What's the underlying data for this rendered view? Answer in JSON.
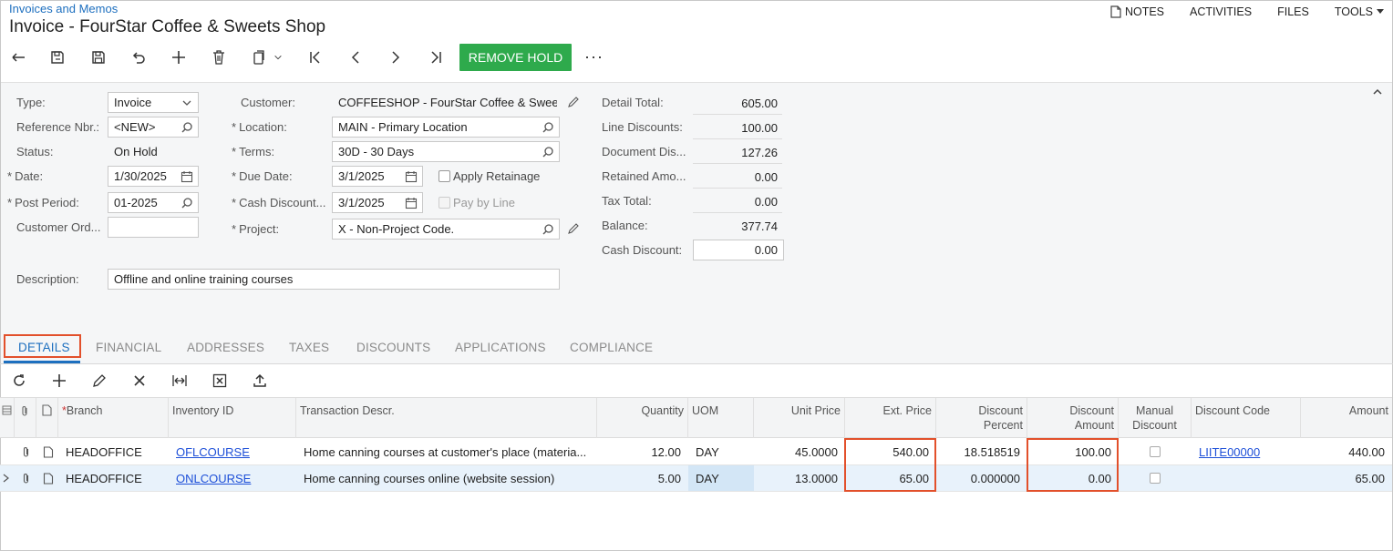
{
  "header": {
    "breadcrumb": "Invoices and Memos",
    "title": "Invoice - FourStar Coffee & Sweets Shop",
    "links": {
      "notes": "NOTES",
      "activities": "ACTIVITIES",
      "files": "FILES",
      "tools": "TOOLS"
    }
  },
  "toolbar": {
    "remove_hold": "REMOVE HOLD",
    "more": "···"
  },
  "form": {
    "type_label": "Type:",
    "type_value": "Invoice",
    "ref_label": "Reference Nbr.:",
    "ref_value": "<NEW>",
    "status_label": "Status:",
    "status_value": "On Hold",
    "date_label": "Date:",
    "date_value": "1/30/2025",
    "period_label": "Post Period:",
    "period_value": "01-2025",
    "custord_label": "Customer Ord...",
    "custord_value": "",
    "customer_label": "Customer:",
    "customer_value": "COFFEESHOP - FourStar Coffee & Sweets Shop",
    "location_label": "Location:",
    "location_value": "MAIN - Primary Location",
    "terms_label": "Terms:",
    "terms_value": "30D - 30 Days",
    "duedate_label": "Due Date:",
    "duedate_value": "3/1/2025",
    "cashdisc_label": "Cash Discount...",
    "cashdisc_value": "3/1/2025",
    "project_label": "Project:",
    "project_value": "X - Non-Project Code.",
    "apply_retainage": "Apply Retainage",
    "pay_by_line": "Pay by Line",
    "description_label": "Description:",
    "description_value": "Offline and online training courses"
  },
  "totals": {
    "detail_total_label": "Detail Total:",
    "detail_total": "605.00",
    "line_disc_label": "Line Discounts:",
    "line_disc": "100.00",
    "doc_disc_label": "Document Dis...",
    "doc_disc": "127.26",
    "retained_label": "Retained Amo...",
    "retained": "0.00",
    "tax_total_label": "Tax Total:",
    "tax_total": "0.00",
    "balance_label": "Balance:",
    "balance": "377.74",
    "cash_discount_label": "Cash Discount:",
    "cash_discount": "0.00"
  },
  "tabs": [
    "DETAILS",
    "FINANCIAL",
    "ADDRESSES",
    "TAXES",
    "DISCOUNTS",
    "APPLICATIONS",
    "COMPLIANCE"
  ],
  "grid": {
    "columns": {
      "branch": "Branch",
      "inventory_id": "Inventory ID",
      "trans_descr": "Transaction Descr.",
      "quantity": "Quantity",
      "uom": "UOM",
      "unit_price": "Unit Price",
      "ext_price": "Ext. Price",
      "disc_pct_1": "Discount",
      "disc_pct_2": "Percent",
      "disc_amt_1": "Discount",
      "disc_amt_2": "Amount",
      "manual_1": "Manual",
      "manual_2": "Discount",
      "disc_code": "Discount Code",
      "amount": "Amount"
    },
    "rows": [
      {
        "branch": "HEADOFFICE",
        "inventory_id": "OFLCOURSE",
        "descr": "Home canning courses at customer's place (materia...",
        "quantity": "12.00",
        "uom": "DAY",
        "unit_price": "45.0000",
        "ext_price": "540.00",
        "disc_pct": "18.518519",
        "disc_amt": "100.00",
        "disc_code": "LIITE00000",
        "amount": "440.00"
      },
      {
        "branch": "HEADOFFICE",
        "inventory_id": "ONLCOURSE",
        "descr": "Home canning courses online (website session)",
        "quantity": "5.00",
        "uom": "DAY",
        "unit_price": "13.0000",
        "ext_price": "65.00",
        "disc_pct": "0.000000",
        "disc_amt": "0.00",
        "disc_code": "",
        "amount": "65.00"
      }
    ]
  }
}
